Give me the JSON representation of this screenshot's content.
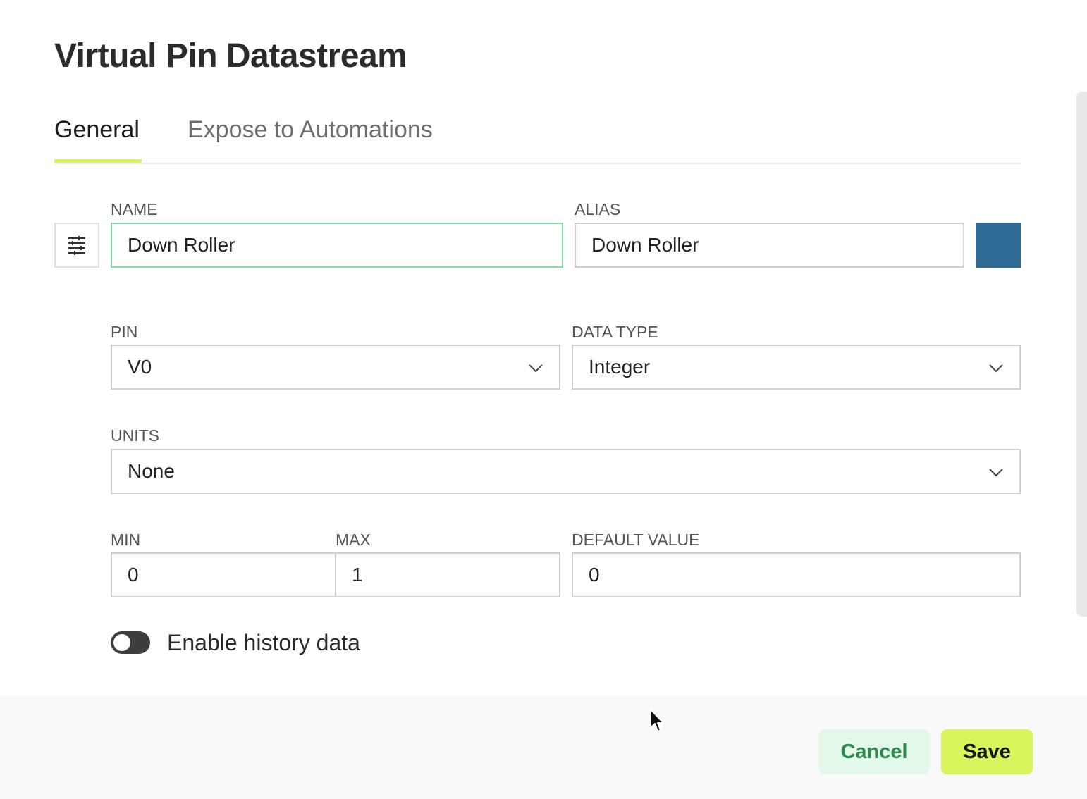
{
  "dialog": {
    "title": "Virtual Pin Datastream"
  },
  "tabs": [
    {
      "label": "General",
      "active": true
    },
    {
      "label": "Expose to Automations",
      "active": false
    }
  ],
  "form": {
    "name": {
      "label": "NAME",
      "value": "Down Roller"
    },
    "alias": {
      "label": "ALIAS",
      "value": "Down Roller"
    },
    "color": "#2e6a93",
    "pin": {
      "label": "PIN",
      "value": "V0"
    },
    "data_type": {
      "label": "DATA TYPE",
      "value": "Integer"
    },
    "units": {
      "label": "UNITS",
      "value": "None"
    },
    "min": {
      "label": "MIN",
      "value": "0"
    },
    "max": {
      "label": "MAX",
      "value": "1"
    },
    "default_value": {
      "label": "DEFAULT VALUE",
      "value": "0"
    },
    "history": {
      "label": "Enable history data",
      "enabled": false
    }
  },
  "footer": {
    "cancel_label": "Cancel",
    "save_label": "Save"
  },
  "icons": {
    "settings_button": "sliders-icon",
    "dropdown": "chevron-down-icon",
    "cursor": "mouse-pointer-icon"
  },
  "colors": {
    "accent": "#d7f55c",
    "focus_border": "#7fe0a4",
    "cancel_bg": "#e2f9ea",
    "cancel_text": "#2e8a4d",
    "toggle_off": "#3d3d3d"
  }
}
